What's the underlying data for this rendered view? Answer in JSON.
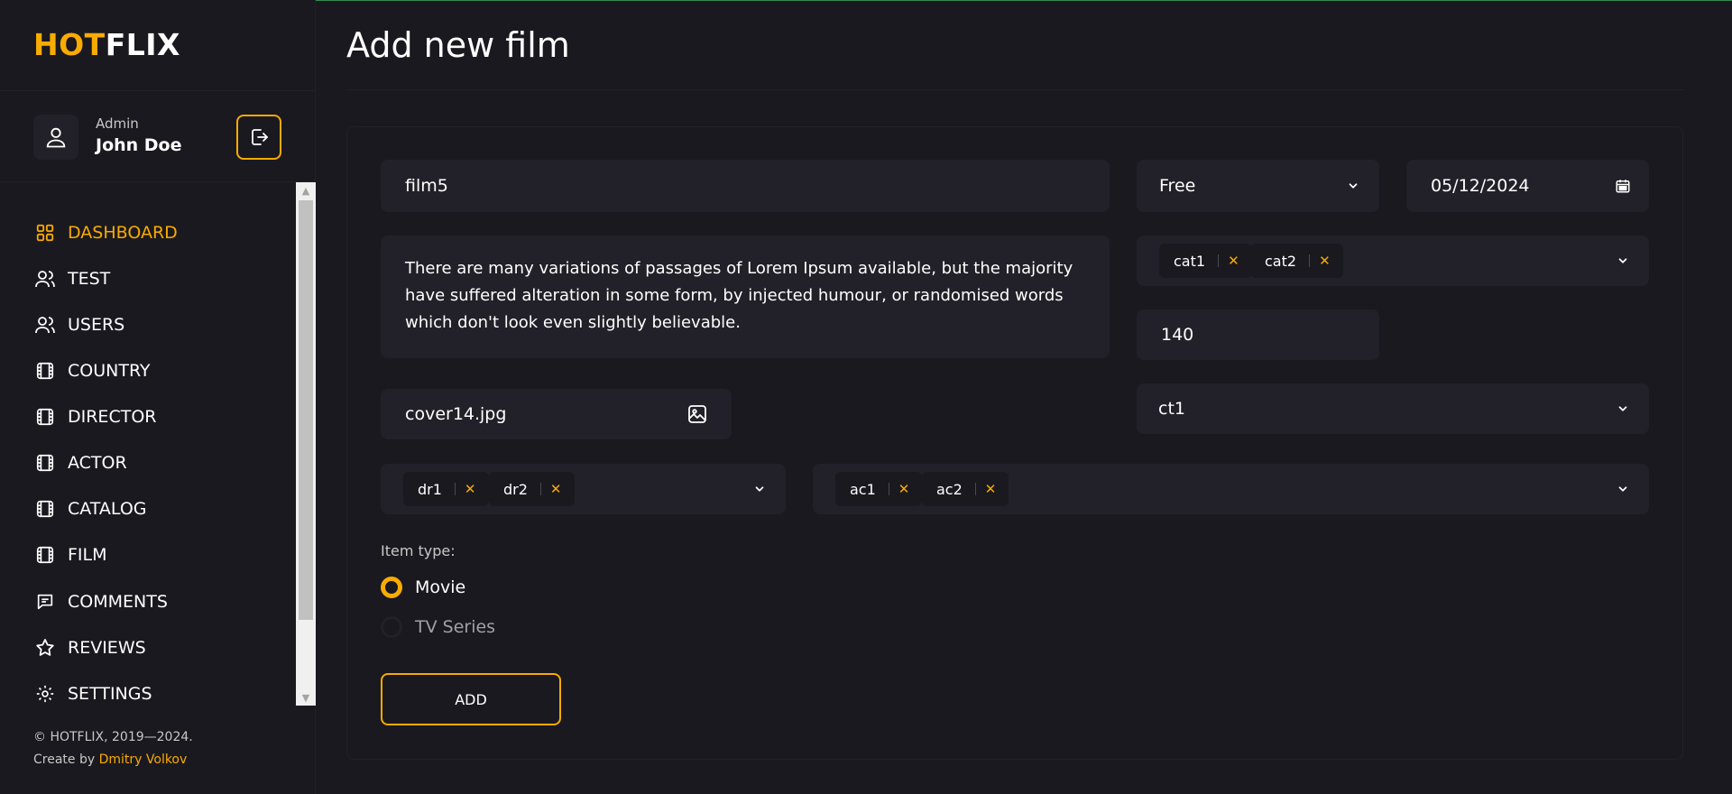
{
  "logo": {
    "part1": "HOT",
    "part2": "FLIX"
  },
  "user": {
    "role": "Admin",
    "name": "John Doe"
  },
  "nav": [
    {
      "label": "DASHBOARD",
      "icon": "grid-icon",
      "active": true
    },
    {
      "label": "TEST",
      "icon": "users-icon"
    },
    {
      "label": "USERS",
      "icon": "users-icon"
    },
    {
      "label": "COUNTRY",
      "icon": "film-icon"
    },
    {
      "label": "DIRECTOR",
      "icon": "film-icon"
    },
    {
      "label": "ACTOR",
      "icon": "film-icon"
    },
    {
      "label": "CATALOG",
      "icon": "film-icon"
    },
    {
      "label": "FILM",
      "icon": "film-icon"
    },
    {
      "label": "COMMENTS",
      "icon": "comment-icon"
    },
    {
      "label": "REVIEWS",
      "icon": "star-icon"
    },
    {
      "label": "SETTINGS",
      "icon": "gear-icon"
    }
  ],
  "footer": {
    "copyright": "© HOTFLIX, 2019—2024.",
    "created_prefix": "Create by",
    "author": "Dmitry Volkov"
  },
  "page": {
    "title": "Add new film"
  },
  "form": {
    "title_value": "film5",
    "subscription_value": "Free",
    "date_value": "05/12/2024",
    "description": "There are many variations of passages of Lorem Ipsum available, but the majority have suffered alteration in some form, by injected humour, or randomised words which don't look even slightly believable.",
    "categories": [
      "cat1",
      "cat2"
    ],
    "duration": "140",
    "cover": "cover14.jpg",
    "catalog_value": "ct1",
    "directors": [
      "dr1",
      "dr2"
    ],
    "actors": [
      "ac1",
      "ac2"
    ],
    "item_type_label": "Item type:",
    "item_types": [
      {
        "label": "Movie",
        "checked": true
      },
      {
        "label": "TV Series",
        "checked": false
      }
    ],
    "submit_label": "ADD"
  },
  "colors": {
    "accent": "#f9ab00",
    "background": "#1a191f",
    "field": "#222129"
  }
}
